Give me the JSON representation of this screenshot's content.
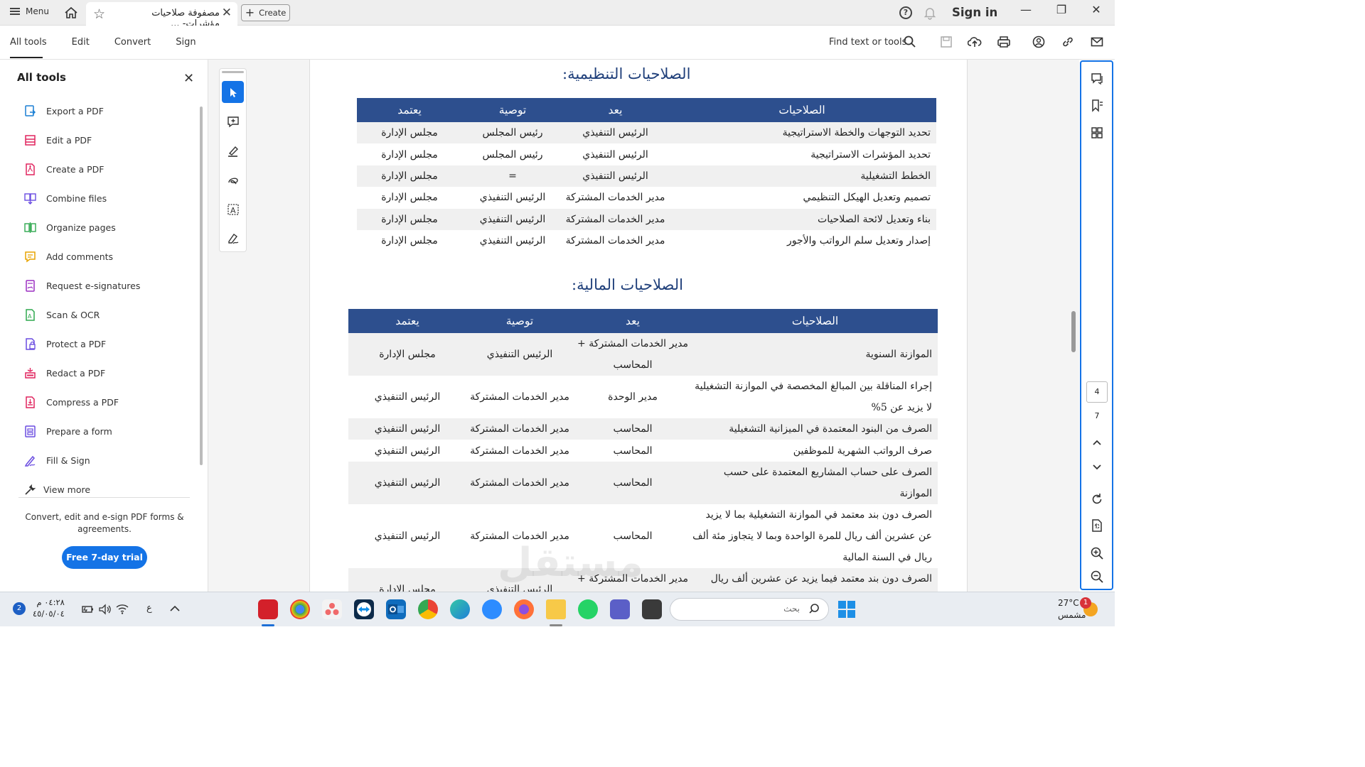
{
  "titlebar": {
    "menu_label": "Menu",
    "tab_title": "مصفوفة صلاحيات مؤشرات- ...",
    "create_label": "Create",
    "signin_label": "Sign in"
  },
  "toolbar": {
    "nav": [
      "All tools",
      "Edit",
      "Convert",
      "Sign"
    ],
    "find_label": "Find text or tools"
  },
  "left_panel": {
    "title": "All tools",
    "items": [
      {
        "label": "Export a PDF",
        "icon": "export-pdf-icon",
        "color": "#1a7fd4"
      },
      {
        "label": "Edit a PDF",
        "icon": "edit-pdf-icon",
        "color": "#e0245e"
      },
      {
        "label": "Create a PDF",
        "icon": "create-pdf-icon",
        "color": "#e0245e"
      },
      {
        "label": "Combine files",
        "icon": "combine-files-icon",
        "color": "#6a4ce0"
      },
      {
        "label": "Organize pages",
        "icon": "organize-pages-icon",
        "color": "#2fa84f"
      },
      {
        "label": "Add comments",
        "icon": "add-comments-icon",
        "color": "#e8a400"
      },
      {
        "label": "Request e-signatures",
        "icon": "request-esign-icon",
        "color": "#9b2fc2"
      },
      {
        "label": "Scan & OCR",
        "icon": "scan-ocr-icon",
        "color": "#2fa84f"
      },
      {
        "label": "Protect a PDF",
        "icon": "protect-pdf-icon",
        "color": "#6a4ce0"
      },
      {
        "label": "Redact a PDF",
        "icon": "redact-pdf-icon",
        "color": "#e0245e"
      },
      {
        "label": "Compress a PDF",
        "icon": "compress-pdf-icon",
        "color": "#e0245e"
      },
      {
        "label": "Prepare a form",
        "icon": "prepare-form-icon",
        "color": "#6a4ce0"
      },
      {
        "label": "Fill & Sign",
        "icon": "fill-sign-icon",
        "color": "#6a4ce0"
      },
      {
        "label": "View more",
        "icon": "view-more-icon",
        "color": "#333333"
      }
    ],
    "promo_text": "Convert, edit and e-sign PDF forms & agreements.",
    "trial_label": "Free 7-day trial"
  },
  "document": {
    "section1": {
      "heading": "الصلاحيات التنظيمية:",
      "headers": [
        "الصلاحيات",
        "يعد",
        "توصية",
        "يعتمد"
      ],
      "rows": [
        [
          "تحديد التوجهات والخطة الاستراتيجية",
          "الرئيس التنفيذي",
          "رئيس المجلس",
          "مجلس الإدارة"
        ],
        [
          "تحديد المؤشرات الاستراتيجية",
          "الرئيس التنفيذي",
          "رئيس المجلس",
          "مجلس الإدارة"
        ],
        [
          "الخطط التشغيلية",
          "الرئيس التنفيذي",
          "=",
          "مجلس الإدارة"
        ],
        [
          "تصميم وتعديل الهيكل التنظيمي",
          "مدير الخدمات المشتركة",
          "الرئيس التنفيذي",
          "مجلس الإدارة"
        ],
        [
          "بناء وتعديل لائحة الصلاحيات",
          "مدير الخدمات المشتركة",
          "الرئيس التنفيذي",
          "مجلس الإدارة"
        ],
        [
          "إصدار وتعديل سلم الرواتب والأجور",
          "مدير الخدمات المشتركة",
          "الرئيس التنفيذي",
          "مجلس الإدارة"
        ]
      ]
    },
    "section2": {
      "heading": "الصلاحيات المالية:",
      "headers": [
        "الصلاحيات",
        "يعد",
        "توصية",
        "يعتمد"
      ],
      "rows": [
        [
          "الموازنة السنوية",
          "مدير الخدمات المشتركة + المحاسب",
          "الرئيس التنفيذي",
          "مجلس الإدارة"
        ],
        [
          "إجراء المناقلة بين المبالغ المخصصة في الموازنة التشغيلية لا يزيد عن 5%",
          "مدير الوحدة",
          "مدير الخدمات المشتركة",
          "الرئيس التنفيذي"
        ],
        [
          "الصرف من البنود المعتمدة في الميزانية التشغيلية",
          "المحاسب",
          "مدير الخدمات المشتركة",
          "الرئيس التنفيذي"
        ],
        [
          "صرف الرواتب الشهرية للموظفين",
          "المحاسب",
          "مدير الخدمات المشتركة",
          "الرئيس التنفيذي"
        ],
        [
          "الصرف على حساب المشاريع المعتمدة على حسب الموازنة",
          "المحاسب",
          "مدير الخدمات المشتركة",
          "الرئيس التنفيذي"
        ],
        [
          "الصرف دون بند معتمد في الموازنة التشغيلية بما لا يزيد عن عشرين ألف ريال للمرة الواحدة وبما لا يتجاوز مئة ألف ريال في السنة المالية",
          "المحاسب",
          "مدير الخدمات المشتركة",
          "الرئيس التنفيذي"
        ],
        [
          "الصرف دون بند معتمد فيما يزيد عن عشرين ألف ريال للمرة الواحدة أو يزيد عن مئة ألف ريال في السنة المالية",
          "مدير الخدمات المشتركة + المحاسب",
          "الرئيس التنفيذي",
          "مجلس الإدارة"
        ]
      ]
    }
  },
  "right_sidebar": {
    "current_page": "4",
    "total_pages": "7"
  },
  "taskbar": {
    "time": "٠٤:٢٨ م",
    "date": "٤٥/٠٥/٠٤",
    "lang": "ع",
    "search_placeholder": "بحث",
    "weather_temp": "27°C",
    "weather_desc": "مشمس",
    "weather_badge": "1",
    "notif_badge": "2"
  },
  "watermark": "مستقل"
}
